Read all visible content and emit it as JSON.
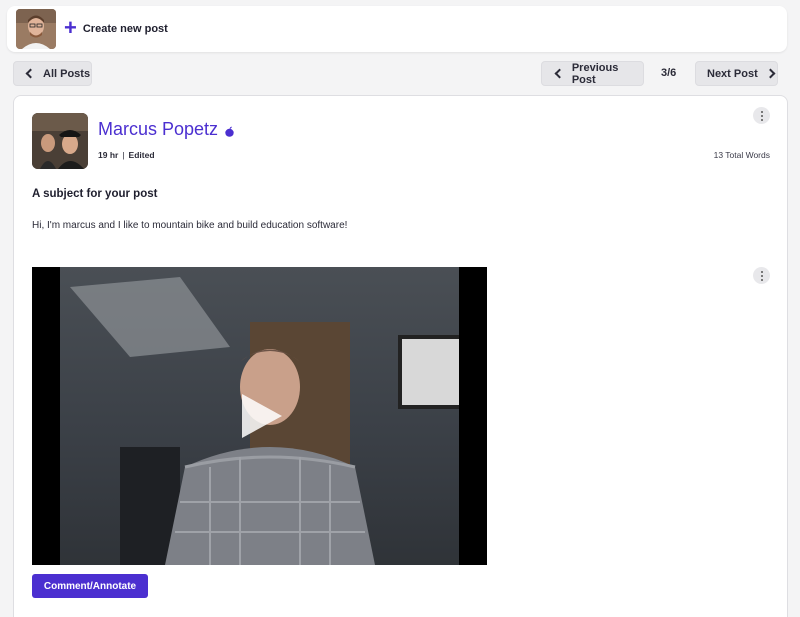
{
  "topbar": {
    "create_label": "Create new post",
    "icons": {
      "avatar": "user-avatar",
      "plus": "plus-icon"
    }
  },
  "nav": {
    "all_posts_label": "All Posts",
    "previous_label": "Previous Post",
    "next_label": "Next Post",
    "counter": "3/6"
  },
  "post": {
    "author_name": "Marcus Popetz",
    "time": "19 hr",
    "separator": "|",
    "edited": "Edited",
    "total_words": "13 Total Words",
    "subject": "A subject for your post",
    "body": "Hi, I'm marcus and I like to mountain bike and build education software!",
    "comment_label": "Comment/Annotate",
    "icons": {
      "badge": "apple-badge-icon",
      "menu": "kebab-menu-icon",
      "play": "play-icon"
    }
  },
  "colors": {
    "accent": "#4b2fd0",
    "background": "#f4f4f5",
    "card": "#ffffff"
  }
}
